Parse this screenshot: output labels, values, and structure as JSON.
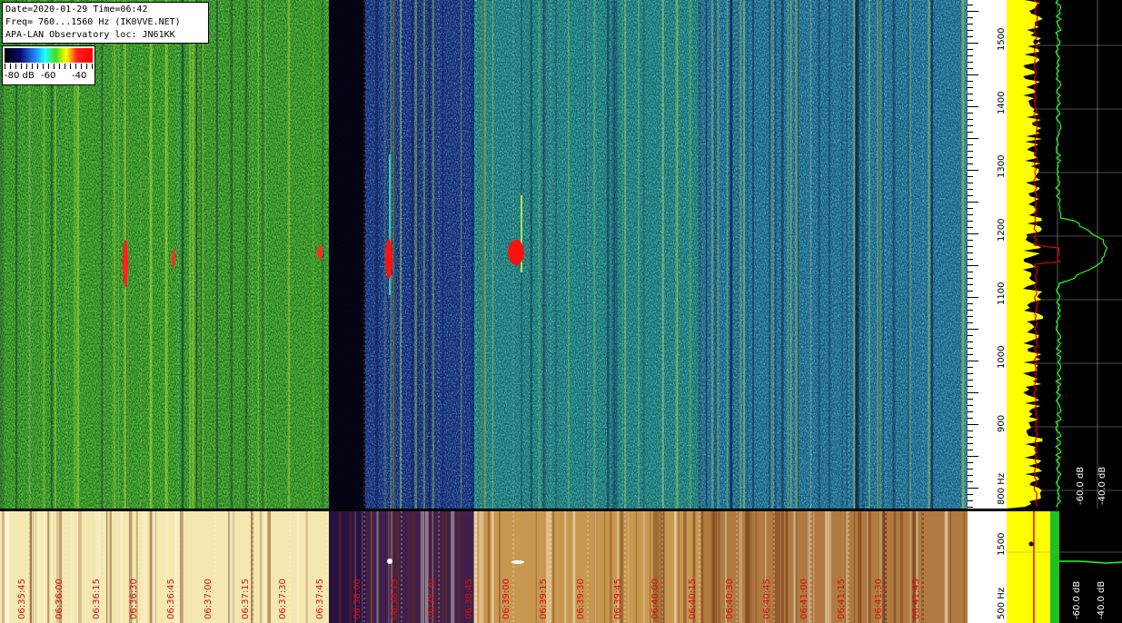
{
  "info": {
    "line1": "Date=2020-01-29 Time=06:42",
    "line2": "Freq= 760...1560 Hz (IK0VVE.NET)",
    "line3": "APA-LAN Observatory loc: JN61KK"
  },
  "colorbar": {
    "label_min": "-80 dB",
    "label_mid": "-60",
    "label_max": "-40"
  },
  "freq_axis": {
    "ticks": [
      "1500",
      "1400",
      "1300",
      "1200",
      "1100",
      "1000",
      "900",
      "800 Hz"
    ]
  },
  "bottom_axis": {
    "ticks": [
      "1500",
      "500 Hz"
    ]
  },
  "time_axis": {
    "ticks": [
      "06:35:45",
      "06:36:00",
      "06:36:15",
      "06:36:30",
      "06:36:45",
      "06:37:00",
      "06:37:15",
      "06:37:30",
      "06:37:45",
      "06:38:00",
      "06:38:15",
      "06:38:30",
      "06:38:45",
      "06:39:00",
      "06:39:15",
      "06:39:30",
      "06:39:45",
      "06:40:00",
      "06:40:15",
      "06:40:30",
      "06:40:45",
      "06:41:00",
      "06:41:15",
      "06:41:30",
      "06:41:45"
    ]
  },
  "spectrum_top": {
    "db_low": "-60.0 dB",
    "db_high": "-40.0 dB"
  },
  "spectrum_bottom": {
    "db_low": "-60.0 dB",
    "db_high": "-40.0 dB"
  },
  "colors": {
    "grid": "#c0c0c0",
    "time_label": "#d01010",
    "spectrum_yellow": "#ffff00",
    "spectrum_green": "#20ff20",
    "spectrum_red": "#e00000"
  }
}
